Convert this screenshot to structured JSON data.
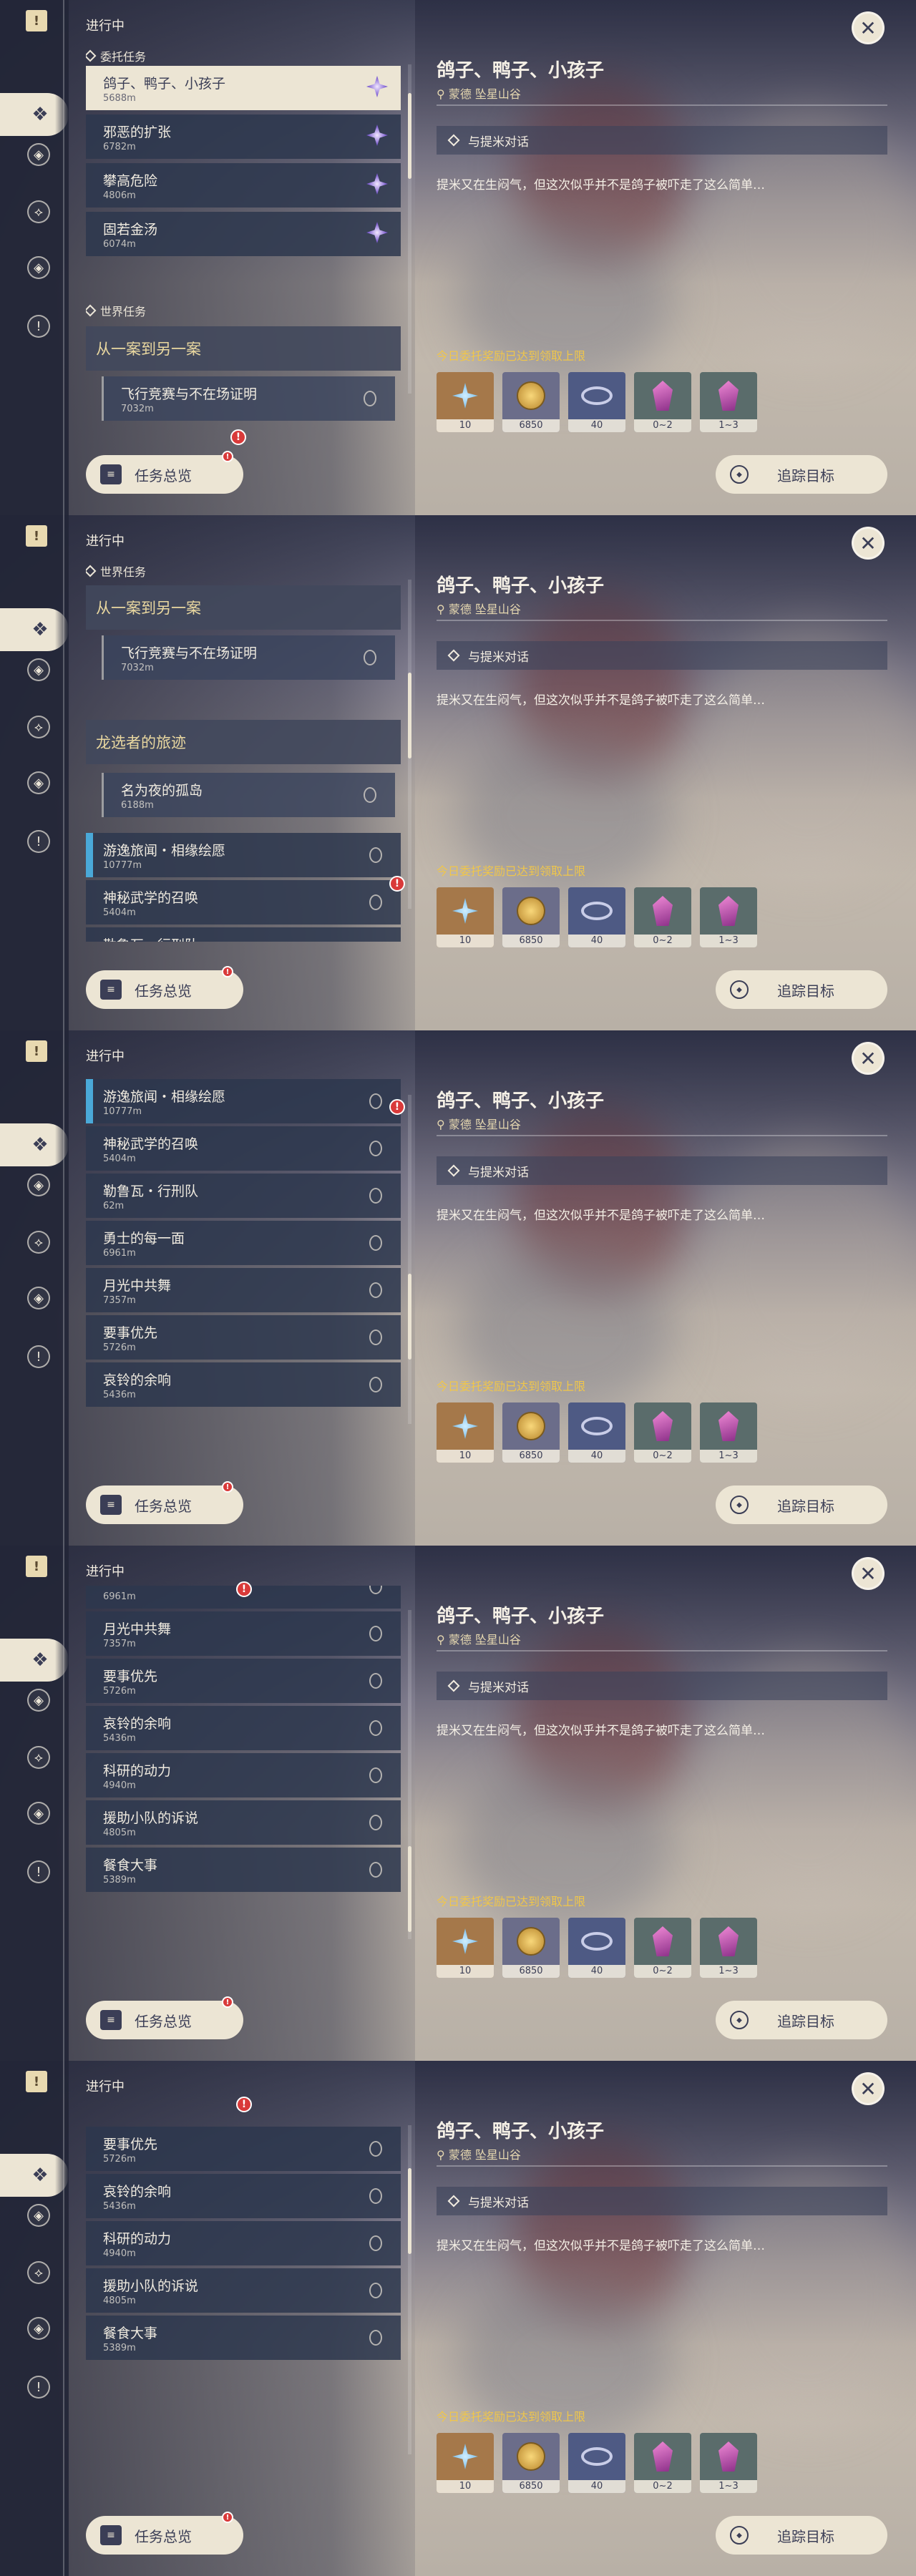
{
  "header": {
    "title": "进行中"
  },
  "close_label": "✕",
  "right": {
    "title": "鸽子、鸭子、小孩子",
    "location": "蒙德 坠星山谷",
    "objective": "与提米对话",
    "description": "提米又在生闷气，但这次似乎并不是鸽子被吓走了这么简单…",
    "reward_note": "今日委托奖励已达到领取上限",
    "rewards": [
      {
        "name": "star",
        "count": "10"
      },
      {
        "name": "mora",
        "count": "6850"
      },
      {
        "name": "eye",
        "count": "40"
      },
      {
        "name": "crystal",
        "count": "0~2"
      },
      {
        "name": "crystal-cluster",
        "count": "1~3"
      }
    ]
  },
  "buttons": {
    "overview": "任务总览",
    "track": "追踪目标"
  },
  "panels": [
    {
      "sections": [
        {
          "label": "委托任务"
        },
        {
          "label": "世界任务"
        }
      ],
      "items": [
        {
          "title": "鸽子、鸭子、小孩子",
          "dist": "5688m"
        },
        {
          "title": "邪恶的扩张",
          "dist": "6782m"
        },
        {
          "title": "攀高危险",
          "dist": "4806m"
        },
        {
          "title": "固若金汤",
          "dist": "6074m"
        }
      ],
      "quest_head": "从一案到另一案",
      "subs": [
        {
          "title": "飞行竞赛与不在场证明",
          "dist": "7032m"
        }
      ]
    },
    {
      "sections": [
        {
          "label": "世界任务"
        }
      ],
      "quest_heads": [
        "从一案到另一案",
        "龙选者的旅迹"
      ],
      "subs": [
        {
          "title": "飞行竞赛与不在场证明",
          "dist": "7032m"
        },
        {
          "title": "名为夜的孤岛",
          "dist": "6188m"
        }
      ],
      "items": [
        {
          "title": "游逸旅闻・相缘绘愿",
          "dist": "10777m"
        },
        {
          "title": "神秘武学的召唤",
          "dist": "5404m"
        },
        {
          "title": "勒鲁瓦・行刑队",
          "dist": ""
        }
      ]
    },
    {
      "items": [
        {
          "title": "游逸旅闻・相缘绘愿",
          "dist": "10777m"
        },
        {
          "title": "神秘武学的召唤",
          "dist": "5404m"
        },
        {
          "title": "勒鲁瓦・行刑队",
          "dist": "62m"
        },
        {
          "title": "勇士的每一面",
          "dist": "6961m"
        },
        {
          "title": "月光中共舞",
          "dist": "7357m"
        },
        {
          "title": "要事优先",
          "dist": "5726m"
        },
        {
          "title": "哀铃的余响",
          "dist": "5436m"
        }
      ]
    },
    {
      "items": [
        {
          "title": "",
          "dist": "6961m"
        },
        {
          "title": "月光中共舞",
          "dist": "7357m"
        },
        {
          "title": "要事优先",
          "dist": "5726m"
        },
        {
          "title": "哀铃的余响",
          "dist": "5436m"
        },
        {
          "title": "科研的动力",
          "dist": "4940m"
        },
        {
          "title": "援助小队的诉说",
          "dist": "4805m"
        },
        {
          "title": "餐食大事",
          "dist": "5389m"
        }
      ]
    },
    {
      "items": [
        {
          "title": "要事优先",
          "dist": "5726m"
        },
        {
          "title": "哀铃的余响",
          "dist": "5436m"
        },
        {
          "title": "科研的动力",
          "dist": "4940m"
        },
        {
          "title": "援助小队的诉说",
          "dist": "4805m"
        },
        {
          "title": "餐食大事",
          "dist": "5389m"
        }
      ]
    }
  ]
}
